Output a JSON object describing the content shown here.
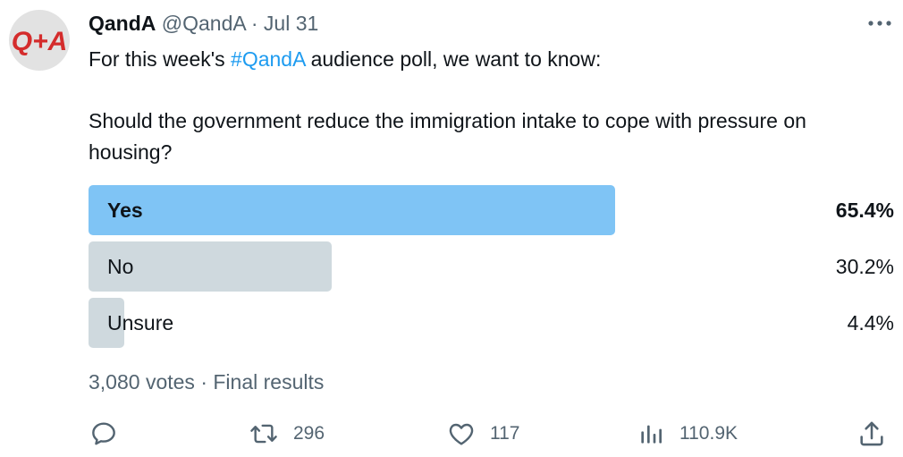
{
  "tweet": {
    "author_name": "QandA",
    "author_handle": "@QandA",
    "separator": "·",
    "date": "Jul 31",
    "avatar_text": "Q+A",
    "text_before_hashtag": "For this week's ",
    "hashtag": "#QandA",
    "text_after_hashtag": " audience poll, we want to know:",
    "question": "Should the government reduce the immigration intake to cope with pressure on housing?"
  },
  "poll": {
    "options": [
      {
        "label": "Yes",
        "percent_text": "65.4%",
        "percent": 65.4,
        "winner": true
      },
      {
        "label": "No",
        "percent_text": "30.2%",
        "percent": 30.2,
        "winner": false
      },
      {
        "label": "Unsure",
        "percent_text": "4.4%",
        "percent": 4.4,
        "winner": false
      }
    ],
    "votes": "3,080 votes",
    "separator": "·",
    "status": "Final results"
  },
  "actions": {
    "reply": {
      "icon": "reply-icon",
      "count": ""
    },
    "retweet": {
      "icon": "retweet-icon",
      "count": "296"
    },
    "like": {
      "icon": "heart-icon",
      "count": "117"
    },
    "views": {
      "icon": "analytics-icon",
      "count": "110.9K"
    },
    "share": {
      "icon": "share-icon"
    }
  },
  "colors": {
    "winner_bar": "#7fc4f5",
    "other_bar": "#cfd9de",
    "hashtag": "#1d9bf0",
    "secondary_text": "#536471",
    "avatar_red": "#d42c2c"
  }
}
